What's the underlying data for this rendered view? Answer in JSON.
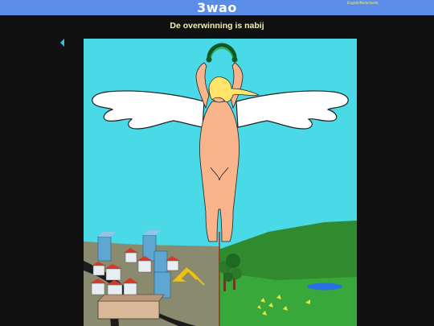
{
  "header": {
    "site_title": "3wao",
    "language_switch": "English/Nederlands"
  },
  "page": {
    "heading": "De overwinning is nabij"
  },
  "navigation": {
    "back_icon": "triangle-left-icon"
  },
  "colors": {
    "topbar": "#5b8de8",
    "background": "#111111",
    "heading_text": "#f4f0b8",
    "site_title_text": "#ffffff",
    "language_text": "#fff566",
    "sky": "#4ad9e6",
    "arrow": "#2ec4dc"
  }
}
